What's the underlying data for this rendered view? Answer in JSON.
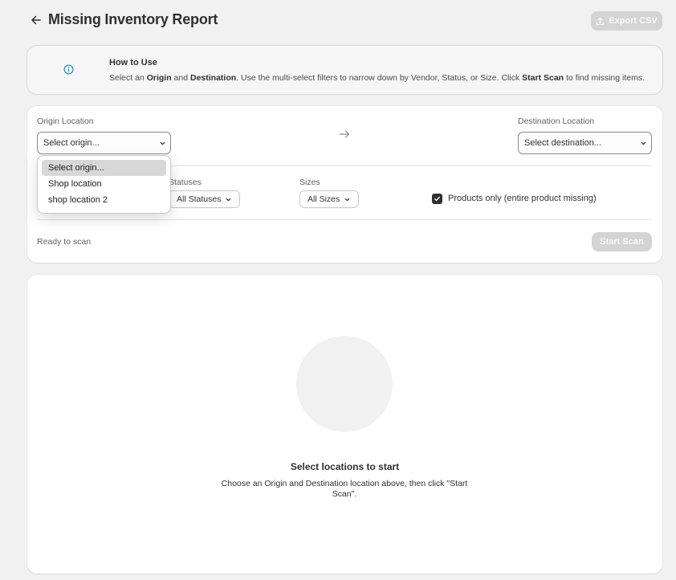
{
  "header": {
    "title": "Missing Inventory Report",
    "export_label": "Export CSV"
  },
  "howto": {
    "title": "How to Use",
    "text_parts": [
      "Select an ",
      "Origin",
      " and ",
      "Destination",
      ". Use the multi-select filters to narrow down by Vendor, Status, or Size. Click ",
      "Start Scan",
      " to find missing items."
    ]
  },
  "config": {
    "origin_label": "Origin Location",
    "origin_value": "Select origin...",
    "destination_label": "Destination Location",
    "destination_value": "Select destination...",
    "statuses_label": "Statuses",
    "statuses_value": "All Statuses",
    "sizes_label": "Sizes",
    "sizes_value": "All Sizes",
    "products_only_label": "Products only (entire product missing)",
    "products_only_checked": true,
    "status_text": "Ready to scan",
    "start_scan_label": "Start Scan"
  },
  "origin_dropdown": {
    "options": [
      "Select origin...",
      "Shop location",
      "shop location 2"
    ],
    "selected_index": 0
  },
  "empty_state": {
    "title": "Select locations to start",
    "text": "Choose an Origin and Destination location above, then click \"Start Scan\"."
  },
  "icons": {
    "back": "arrow-left-icon",
    "export": "upload-icon",
    "info": "info-icon",
    "location_arrow": "arrow-right-icon",
    "caret": "chevron-down-icon",
    "check": "checkmark-icon"
  },
  "colors": {
    "background": "#f1f1f1",
    "info_blue": "#0094d5",
    "disabled_button": "#d4d4d4",
    "text": "#303030"
  }
}
